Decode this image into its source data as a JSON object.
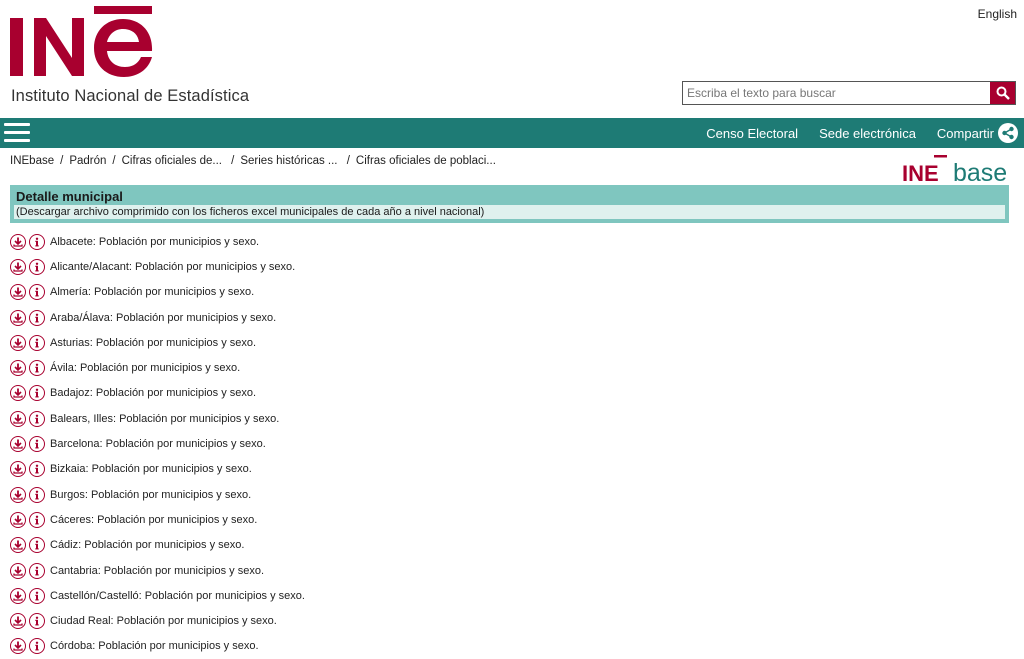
{
  "header": {
    "language_link": "English",
    "logo_text": "INE",
    "logo_subtitle": "Instituto Nacional de Estadística",
    "search_placeholder": "Escriba el texto para buscar"
  },
  "nav": {
    "links": [
      "Censo Electoral",
      "Sede electrónica",
      "Compartir"
    ]
  },
  "breadcrumb": [
    "INEbase",
    "Padrón",
    "Cifras oficiales de...",
    "Series históricas ...",
    "Cifras oficiales de poblaci..."
  ],
  "inebase_logo": {
    "ine": "INE",
    "base": "base"
  },
  "section": {
    "title": "Detalle municipal",
    "subtitle": "(Descargar archivo comprimido con los ficheros excel municipales de cada año a nivel nacional)"
  },
  "items": [
    "Albacete: Población por municipios y sexo.",
    "Alicante/Alacant: Población por municipios y sexo.",
    "Almería: Población por municipios y sexo.",
    "Araba/Álava: Población por municipios y sexo.",
    "Asturias: Población por municipios y sexo.",
    "Ávila: Población por municipios y sexo.",
    "Badajoz: Población por municipios y sexo.",
    "Balears, Illes: Población por municipios y sexo.",
    "Barcelona: Población por municipios y sexo.",
    "Bizkaia: Población por municipios y sexo.",
    "Burgos: Población por municipios y sexo.",
    "Cáceres: Población por municipios y sexo.",
    "Cádiz: Población por municipios y sexo.",
    "Cantabria: Población por municipios y sexo.",
    "Castellón/Castelló: Población por municipios y sexo.",
    "Ciudad Real: Población por municipios y sexo.",
    "Córdoba: Población por municipios y sexo."
  ],
  "icons": {
    "download": "download-icon",
    "info": "info-icon",
    "share": "share-icon",
    "search": "search-icon",
    "menu": "menu-icon"
  },
  "colors": {
    "brand": "#a8002f",
    "teal": "#1e7b75",
    "section_bg": "#7fc6bf",
    "section_sub_bg": "#dff1ee"
  }
}
